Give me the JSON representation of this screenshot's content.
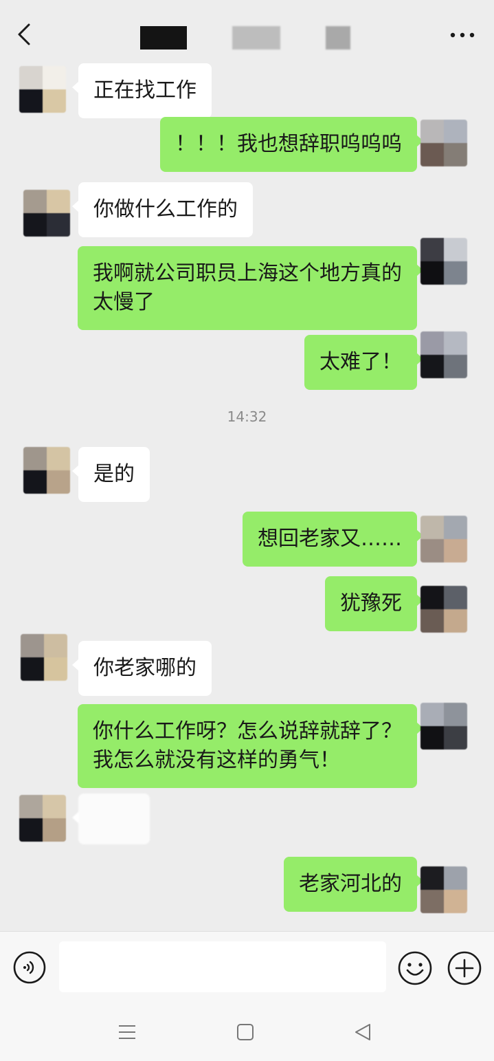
{
  "header": {
    "title": "",
    "back_icon": "chevron-left-icon",
    "more_icon": "more-dots-icon"
  },
  "messages": [
    {
      "side": "in",
      "text": "正在找工作"
    },
    {
      "side": "out",
      "text": "！！！我也想辞职呜呜呜"
    },
    {
      "side": "in",
      "text": "你做什么工作的"
    },
    {
      "side": "out",
      "text": "我啊就公司职员上海这个地方真的\n太慢了"
    },
    {
      "side": "out",
      "text": "太难了！"
    },
    {
      "side": "time",
      "text": "14:32"
    },
    {
      "side": "in",
      "text": "是的"
    },
    {
      "side": "out",
      "text": "想回老家又……"
    },
    {
      "side": "out",
      "text": "犹豫死"
    },
    {
      "side": "in",
      "text": "你老家哪的"
    },
    {
      "side": "out",
      "text": "你什么工作呀？怎么说辞就辞了？\n我怎么就没有这样的勇气！"
    },
    {
      "side": "in",
      "text": ""
    },
    {
      "side": "out",
      "text": "老家河北的"
    }
  ],
  "input_bar": {
    "voice_icon": "voice-icon",
    "input_value": "",
    "emoji_icon": "emoji-icon",
    "plus_icon": "plus-circle-icon"
  },
  "system_nav": {
    "menu_icon": "menu-icon",
    "home_icon": "home-square-icon",
    "back_icon": "back-triangle-icon"
  },
  "colors": {
    "background": "#ededed",
    "incoming_bubble": "#ffffff",
    "outgoing_bubble": "#95ec69",
    "timestamp_text": "#8a8a8a"
  }
}
